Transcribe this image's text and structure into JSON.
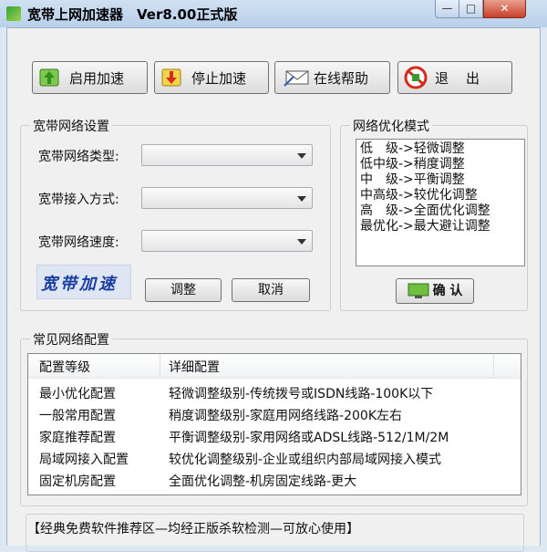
{
  "window": {
    "title": "宽带上网加速器　Ver8.00正式版",
    "min": "—",
    "max": "□",
    "close": "✕"
  },
  "toolbar": {
    "start": "启用加速",
    "stop": "停止加速",
    "help": "在线帮助",
    "exit": "退　出"
  },
  "settings": {
    "group_label": "宽带网络设置",
    "type_label": "宽带网络类型:",
    "access_label": "宽带接入方式:",
    "speed_label": "宽带网络速度:",
    "type_value": "",
    "access_value": "",
    "speed_value": "",
    "logo_text": "宽带加速",
    "adjust": "调整",
    "cancel": "取消"
  },
  "mode": {
    "group_label": "网络优化模式",
    "items": [
      "低　级->轻微调整",
      "低中级->稍度调整",
      "中　级->平衡调整",
      "中高级->较优化调整",
      "高　级->全面优化调整",
      "最优化->最大避让调整"
    ],
    "confirm": "确 认"
  },
  "common": {
    "group_label": "常见网络配置",
    "headers": [
      "配置等级",
      "详细配置"
    ],
    "rows": [
      [
        "最小优化配置",
        "轻微调整级别-传统拨号或ISDN线路-100K以下"
      ],
      [
        "一般常用配置",
        "稍度调整级别-家庭用网络线路-200K左右"
      ],
      [
        "家庭推荐配置",
        "平衡调整级别-家用网络或ADSL线路-512/1M/2M"
      ],
      [
        "局域网接入配置",
        "较优化调整级别-企业或组织内部局域网接入模式"
      ],
      [
        "固定机房配置",
        "全面优化调整-机房固定线路-更大"
      ]
    ]
  },
  "footer": {
    "text": "【经典免费软件推荐区—均经正版杀软检测—可放心使用】"
  },
  "colors": {
    "titlebar": "#b9d0ea",
    "close": "#c7412a",
    "face": "#f0f0f0",
    "logo": "#1b3fa0"
  }
}
